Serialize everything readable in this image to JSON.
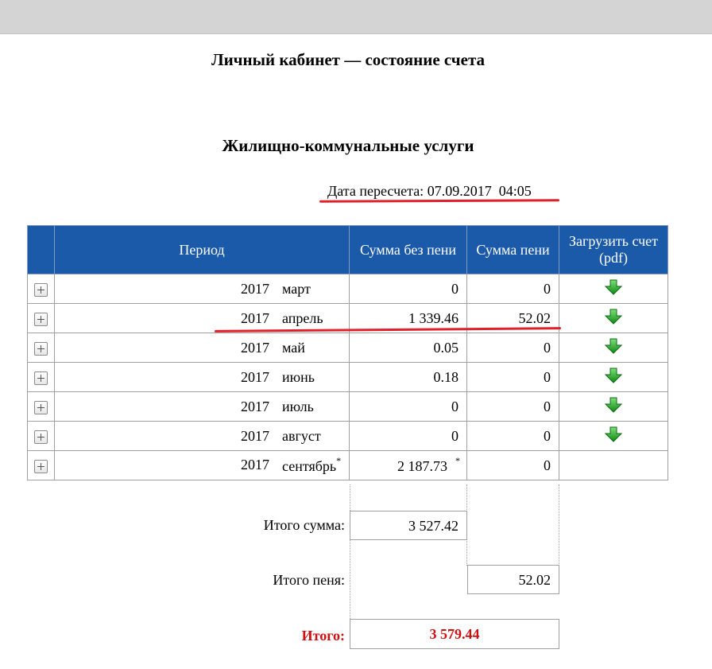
{
  "page": {
    "title": "Личный кабинет — состояние счета",
    "section": "Жилищно-коммунальные услуги",
    "recalc_label": "Дата пересчета:",
    "recalc_date": "07.09.2017",
    "recalc_time": "04:05"
  },
  "table": {
    "headers": {
      "period": "Период",
      "sum": "Сумма без пени",
      "penalty": "Сумма пени",
      "download_line1": "Загрузить счет",
      "download_line2": "(pdf)"
    },
    "rows": [
      {
        "year": "2017",
        "month": "март",
        "sum": "0",
        "penalty": "0",
        "download": true
      },
      {
        "year": "2017",
        "month": "апрель",
        "sum": "1 339.46",
        "penalty": "52.02",
        "download": true
      },
      {
        "year": "2017",
        "month": "май",
        "sum": "0.05",
        "penalty": "0",
        "download": true
      },
      {
        "year": "2017",
        "month": "июнь",
        "sum": "0.18",
        "penalty": "0",
        "download": true
      },
      {
        "year": "2017",
        "month": "июль",
        "sum": "0",
        "penalty": "0",
        "download": true
      },
      {
        "year": "2017",
        "month": "август",
        "sum": "0",
        "penalty": "0",
        "download": true
      },
      {
        "year": "2017",
        "month": "сентябрь",
        "month_mark": "*",
        "sum": "2 187.73",
        "sum_mark": "*",
        "penalty": "0",
        "download": false
      }
    ]
  },
  "totals": {
    "sum_label": "Итого сумма:",
    "sum_value": "3 527.42",
    "penalty_label": "Итого пеня:",
    "penalty_value": "52.02",
    "total_label": "Итого:",
    "total_value": "3 579.44",
    "total_color": "#d01010"
  },
  "colors": {
    "header_bg": "#1a5aa8",
    "annotation_red": "#e0202a",
    "download_green": "#1fae1f"
  },
  "icons": {
    "expand": "plus-box-icon",
    "download": "green-down-arrow-icon"
  }
}
